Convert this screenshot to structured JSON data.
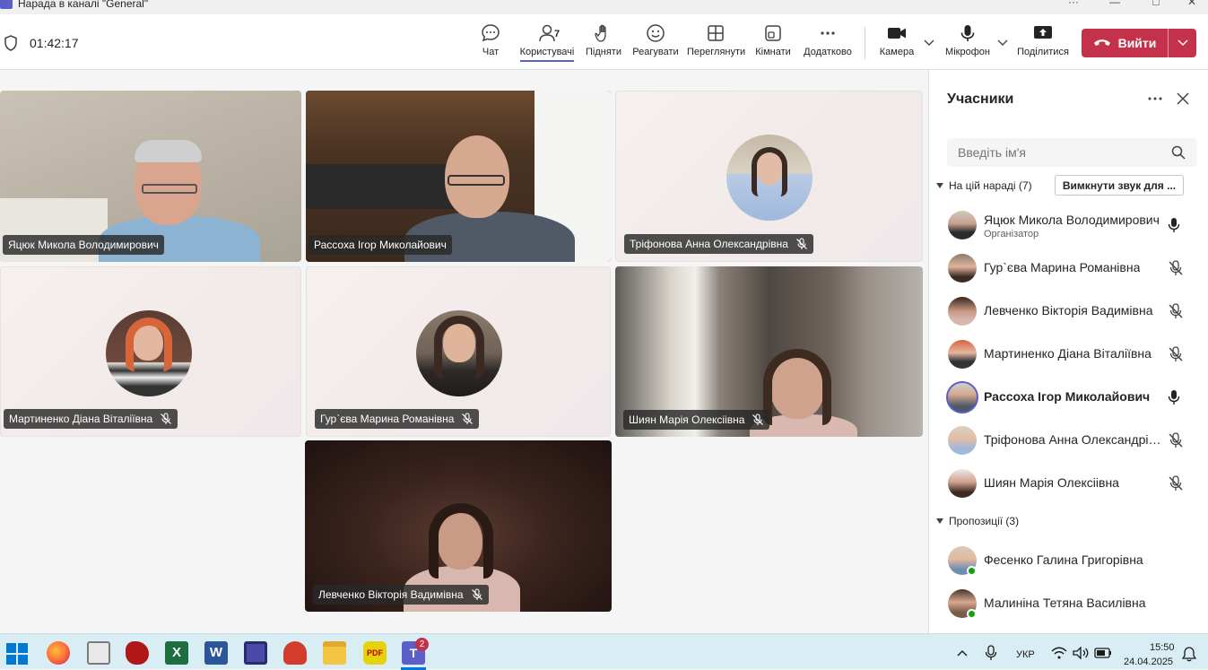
{
  "window": {
    "title": "Нарада в каналі \"General\""
  },
  "toolbar": {
    "timer": "01:42:17",
    "people_count": "7",
    "buttons": {
      "chat": "Чат",
      "people": "Користувачі",
      "raise": "Підняти",
      "react": "Реагувати",
      "view": "Переглянути",
      "rooms": "Кімнати",
      "more": "Додатково",
      "camera": "Камера",
      "mic": "Мікрофон",
      "share": "Поділитися"
    },
    "leave": "Вийти"
  },
  "tiles": [
    {
      "name": "Яцюк Микола Володимирович",
      "muted": false
    },
    {
      "name": "Рассоха Ігор Миколайович",
      "muted": false
    },
    {
      "name": "Тріфонова Анна Олександрівна",
      "muted": true
    },
    {
      "name": "Мартиненко Діана Віталіївна",
      "muted": true
    },
    {
      "name": "Гур`єва Марина Романівна",
      "muted": true
    },
    {
      "name": "Шиян Марія Олексіівна",
      "muted": true
    },
    {
      "name": "Левченко Вікторія Вадимівна",
      "muted": true
    }
  ],
  "panel": {
    "title": "Учасники",
    "search_placeholder": "Введіть ім'я",
    "in_meeting_label": "На цій нараді (7)",
    "mute_all": "Вимкнути звук для ...",
    "participants": [
      {
        "name": "Яцюк Микола Володимирович",
        "role": "Організатор",
        "muted": false
      },
      {
        "name": "Гур`єва Марина Романівна",
        "muted": true
      },
      {
        "name": "Левченко Вікторія Вадимівна",
        "muted": true
      },
      {
        "name": "Мартиненко Діана Віталіївна",
        "muted": true
      },
      {
        "name": "Рассоха Ігор Миколайович",
        "muted": false,
        "speaking": true
      },
      {
        "name": "Тріфонова Анна Олександрівна",
        "muted": true
      },
      {
        "name": "Шиян Марія Олексіівна",
        "muted": true
      }
    ],
    "suggestions_label": "Пропозиції (3)",
    "suggestions": [
      {
        "name": "Фесенко Галина Григорівна"
      },
      {
        "name": "Малиніна Тетяна Василівна"
      }
    ]
  },
  "taskbar": {
    "teams_badge": "2",
    "language": "УКР",
    "time": "15:50",
    "date": "24.04.2025"
  },
  "colors": {
    "accent": "#5b5fc7",
    "leave": "#c4314b",
    "online": "#13a10e"
  }
}
